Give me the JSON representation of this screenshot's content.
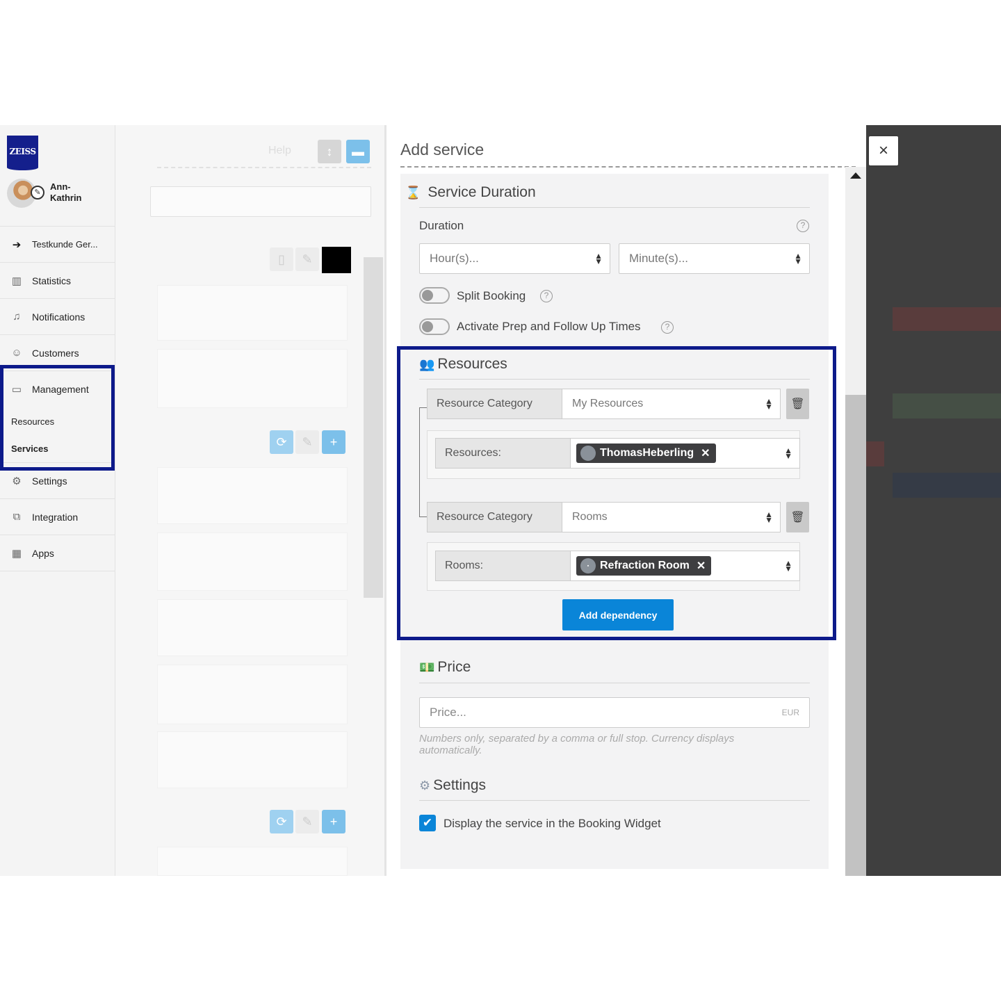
{
  "sidebar": {
    "logo": "ZEISS",
    "user_name": "Ann-\nKathrin",
    "items": [
      {
        "icon": "arrow-circle-left-icon",
        "label": "Testkunde Ger..."
      },
      {
        "icon": "bar-chart-icon",
        "label": "Statistics"
      },
      {
        "icon": "bell-icon",
        "label": "Notifications"
      },
      {
        "icon": "user-icon",
        "label": "Customers"
      },
      {
        "icon": "briefcase-icon",
        "label": "Management"
      }
    ],
    "sub_items": [
      {
        "label": "Resources"
      },
      {
        "label": "Services"
      }
    ],
    "items_bottom": [
      {
        "icon": "gears-icon",
        "label": "Settings"
      },
      {
        "icon": "puzzle-icon",
        "label": "Integration"
      },
      {
        "icon": "grid-icon",
        "label": "Apps"
      }
    ]
  },
  "middle": {
    "help_label": "Help"
  },
  "modal": {
    "title": "Add service",
    "service_duration": {
      "heading": "Service Duration",
      "duration_label": "Duration",
      "hours_placeholder": "Hour(s)...",
      "minutes_placeholder": "Minute(s)...",
      "split_booking_label": "Split Booking",
      "prep_label": "Activate Prep and Follow Up Times"
    },
    "resources": {
      "heading": "Resources",
      "category_label": "Resource Category",
      "category1_value": "My Resources",
      "resources_label": "Resources:",
      "resource_tag": "ThomasHeberling",
      "category2_value": "Rooms",
      "rooms_label": "Rooms:",
      "room_tag": "Refraction Room",
      "add_dependency_label": "Add dependency"
    },
    "price": {
      "heading": "Price",
      "placeholder": "Price...",
      "currency": "EUR",
      "hint": "Numbers only, separated by a comma or full stop. Currency displays automatically."
    },
    "settings": {
      "heading": "Settings",
      "display_widget_label": "Display the service in the Booking Widget",
      "display_widget_checked": true
    }
  },
  "colors": {
    "accent": "#0a85d8",
    "highlight_border": "#0d1a8a",
    "brand": "#141f8c"
  }
}
